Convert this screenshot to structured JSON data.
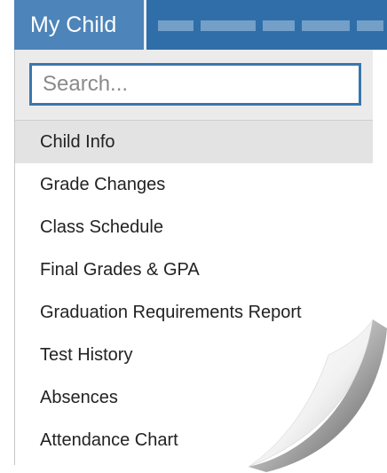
{
  "nav": {
    "active_tab": "My Child"
  },
  "search": {
    "placeholder": "Search..."
  },
  "menu": {
    "items": [
      {
        "label": "Child Info",
        "selected": true
      },
      {
        "label": "Grade Changes",
        "selected": false
      },
      {
        "label": "Class Schedule",
        "selected": false
      },
      {
        "label": "Final Grades & GPA",
        "selected": false
      },
      {
        "label": "Graduation Requirements Report",
        "selected": false
      },
      {
        "label": "Test History",
        "selected": false
      },
      {
        "label": "Absences",
        "selected": false
      },
      {
        "label": "Attendance Chart",
        "selected": false
      }
    ]
  },
  "colors": {
    "nav_background": "#2f6ea8",
    "active_tab_background": "#4d84b9",
    "search_border": "#3a77ad",
    "selected_item_background": "#e3e3e3"
  }
}
